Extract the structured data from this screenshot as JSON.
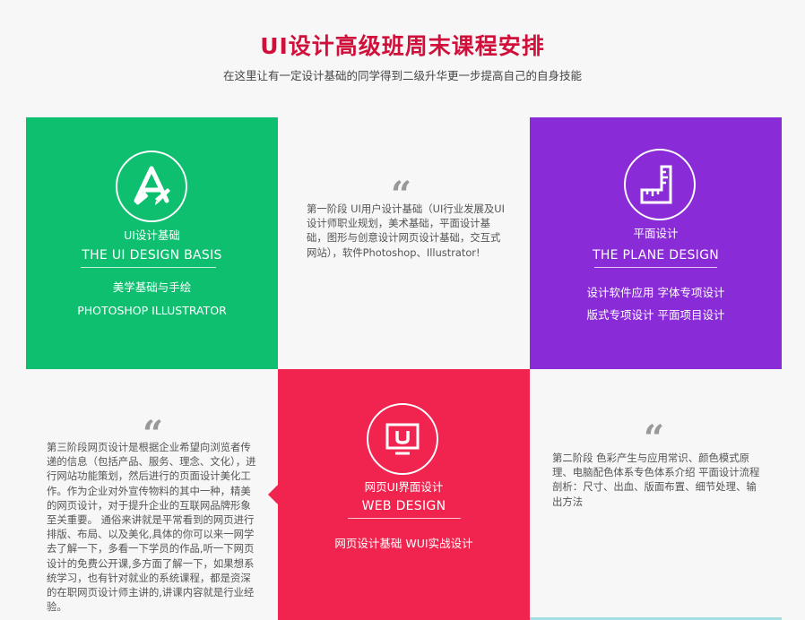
{
  "header": {
    "title": "UI设计高级班周末课程安排",
    "subtitle": "在这里让有一定设计基础的同学得到二级升华更一步提高自己的自身技能"
  },
  "colors": {
    "green": "#0dbf6f",
    "purple": "#8a2bd8",
    "red": "#f0244e",
    "title_red": "#d0103a"
  },
  "quote_mark": "“",
  "tiles": {
    "ui_basis": {
      "icon": "app-store-pencil-brush-icon",
      "cn_label": "UI设计基础",
      "en_label": "THE UI DESIGN BASIS",
      "line1": "美学基础与手绘",
      "line2": "PHOTOSHOP  ILLUSTRATOR"
    },
    "plane_design": {
      "icon": "ruler-square-icon",
      "cn_label": "平面设计",
      "en_label": "THE PLANE DESIGN",
      "line1": "设计软件应用  字体专项设计",
      "line2": "版式专项设计  平面项目设计"
    },
    "web_design": {
      "icon": "monitor-u-icon",
      "cn_label": "网页UI界面设计",
      "en_label": "WEB DESIGN",
      "line1": "网页设计基础  WUI实战设计"
    }
  },
  "stages": {
    "stage1": "第一阶段 UI用户设计基础（UI行业发展及UI设计师职业规划，美术基础，平面设计基础，图形与创意设计网页设计基础，交互式网站），软件Photoshop、Illustrator!",
    "stage2": "第二阶段 色彩产生与应用常识、颜色模式原理、电脑配色体系专色体系介绍 平面设计流程剖析：尺寸、出血、版面布置、细节处理、输出方法",
    "stage3": "第三阶段网页设计是根据企业希望向浏览者传递的信息（包括产品、服务、理念、文化），进行网站功能策划，然后进行的页面设计美化工作。作为企业对外宣传物料的其中一种，精美的网页设计，对于提升企业的互联网品牌形象至关重要。 通俗来讲就是平常看到的网页进行排版、布局、以及美化,具体的你可以来一网学去了解一下，多看一下学员的作品,听一下网页设计的免费公开课,多方面了解一下，如果想系统学习，也有针对就业的系统课程，都是资深的在职网页设计师主讲的,讲课内容就是行业经验。"
  }
}
